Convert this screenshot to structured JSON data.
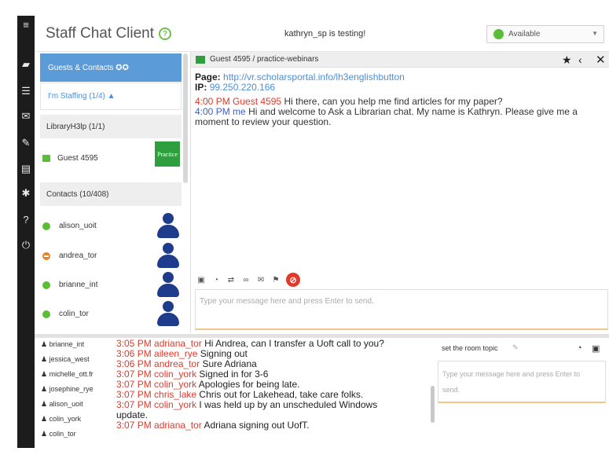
{
  "colors": {
    "accent_blue": "#5b9bd8",
    "available_green": "#5bbd35",
    "busy_orange": "#e8832a",
    "timestamp_red": "#e03a2a",
    "me_blue": "#3a5ec7",
    "sidebar_dark": "#1c1c1c",
    "practice_green": "#2f9e3f"
  },
  "sidebar": {
    "icons": [
      "menu-icon",
      "chat-icon",
      "list-icon",
      "mail-icon",
      "pencil-icon",
      "document-icon",
      "gear-icon",
      "help-icon",
      "power-icon"
    ]
  },
  "header": {
    "app_title": "Staff Chat Client",
    "status_message": "kathryn_sp is testing!",
    "availability": "Available"
  },
  "left_panel": {
    "tab_guests": "Guests & Contacts ✪✪",
    "tab_staffing": "I'm Staffing (1/4) ▲",
    "queue_header": "LibraryH3lp (1/1)",
    "guest": {
      "name": "Guest 4595",
      "badge": "Practice"
    },
    "contacts_header": "Contacts (10/408)",
    "contacts": [
      {
        "name": "alison_uoit",
        "status": "available"
      },
      {
        "name": "andrea_tor",
        "status": "busy"
      },
      {
        "name": "brianne_int",
        "status": "available"
      },
      {
        "name": "colin_tor",
        "status": "available"
      }
    ]
  },
  "chat": {
    "title": "Guest 4595 / practice-webinars",
    "page_label": "Page:",
    "page_url": "http://vr.scholarsportal.info/lh3englishbutton",
    "ip_label": "IP:",
    "ip_value": "99.250.220.166",
    "messages": [
      {
        "time": "4:00 PM",
        "sender": "Guest 4595",
        "text": "Hi there, can you help me find articles for my paper?"
      },
      {
        "time": "4:00 PM",
        "sender": "me",
        "text": "Hi and welcome to Ask a Librarian chat. My name is Kathryn. Please give me a moment to review your question."
      }
    ],
    "input_placeholder": "Type your message here and press Enter to send."
  },
  "staff_list": [
    "brianne_int",
    "jessica_west",
    "michelle_ott.fr",
    "josephine_rye",
    "alison_uoit",
    "colin_york",
    "colin_tor"
  ],
  "staff_log": [
    {
      "time": "3:05 PM",
      "user": "adriana_tor",
      "text": "Hi Andrea, can I transfer a Uoft call to you?"
    },
    {
      "time": "3:06 PM",
      "user": "aileen_rye",
      "text": "Signing out"
    },
    {
      "time": "3:06 PM",
      "user": "andrea_tor",
      "text": "Sure Adriana"
    },
    {
      "time": "3:07 PM",
      "user": "colin_york",
      "text": "Signed in for 3-6"
    },
    {
      "time": "3:07 PM",
      "user": "colin_york",
      "text": "Apologies for being late."
    },
    {
      "time": "3:07 PM",
      "user": "chris_lake",
      "text": "Chris out for Lakehead, take care folks."
    },
    {
      "time": "3:07 PM",
      "user": "colin_york",
      "text": "I was held up by an unscheduled Windows"
    },
    {
      "time": "",
      "user": "",
      "text": "update."
    },
    {
      "time": "3:07 PM",
      "user": "adriana_tor",
      "text": "Adriana signing out UofT."
    }
  ],
  "room": {
    "topic": "set the room topic",
    "input_placeholder": "Type your message here and press Enter to send."
  }
}
